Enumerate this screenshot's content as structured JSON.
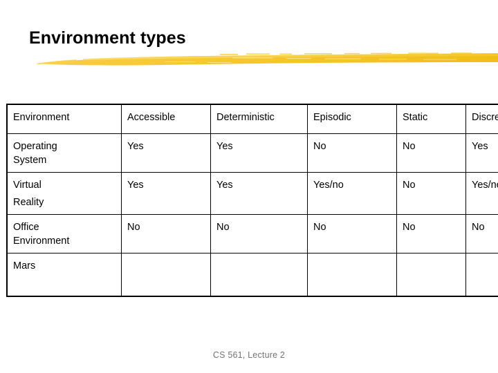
{
  "slide": {
    "title": "Environment types",
    "accent_color": "#F5C52C",
    "background_color": "#FFFFFF",
    "footer": "CS 561,  Lecture 2"
  },
  "table": {
    "columns": [
      "Environment",
      "Accessible",
      "Deterministic",
      "Episodic",
      "Static",
      "Discrete"
    ],
    "rows": [
      {
        "name_lines": [
          "Operating",
          "System"
        ],
        "values": [
          "Yes",
          "Yes",
          "No",
          "No",
          "Yes"
        ]
      },
      {
        "name_lines": [
          "Virtual",
          "Reality"
        ],
        "values": [
          "Yes",
          "Yes",
          "Yes/no",
          "No",
          "Yes/no"
        ]
      },
      {
        "name_lines": [
          "Office",
          "Environment"
        ],
        "values": [
          "No",
          "No",
          "No",
          "No",
          "No"
        ]
      },
      {
        "name_lines": [
          "Mars",
          ""
        ],
        "values": [
          "",
          "",
          "",
          "",
          ""
        ]
      }
    ]
  }
}
